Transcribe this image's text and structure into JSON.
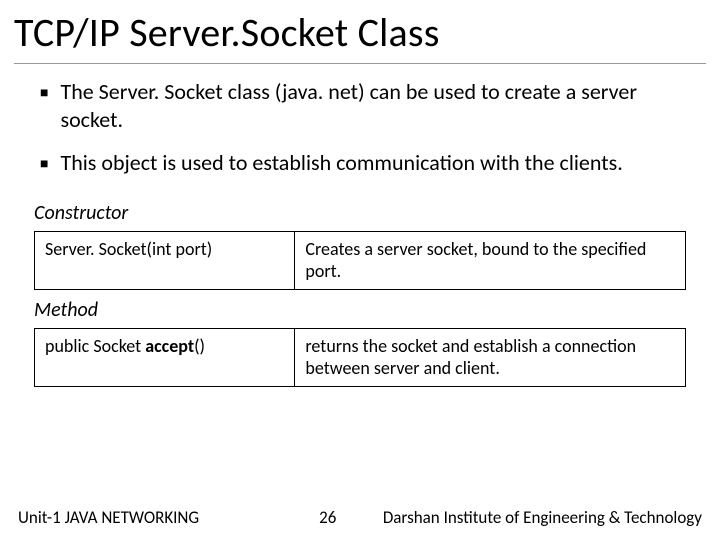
{
  "title": "TCP/IP Server.Socket Class",
  "bullets": [
    "The Server. Socket class (java. net) can be used to create a server socket.",
    "This object is used to establish communication with the clients."
  ],
  "sections": [
    {
      "heading": "Constructor",
      "rows": [
        {
          "c1a": "Server. Socket(int port)",
          "c1b": "",
          "c2": "Creates a server socket, bound to the specified port."
        }
      ]
    },
    {
      "heading": "Method",
      "rows": [
        {
          "c1a": "public Socket ",
          "c1b": "accept",
          "c1c": "()",
          "c2": "returns the socket and establish a connection between server and client."
        }
      ]
    }
  ],
  "footer": {
    "left": "Unit-1 JAVA NETWORKING",
    "page": "26",
    "right": "Darshan Institute of Engineering & Technology"
  }
}
